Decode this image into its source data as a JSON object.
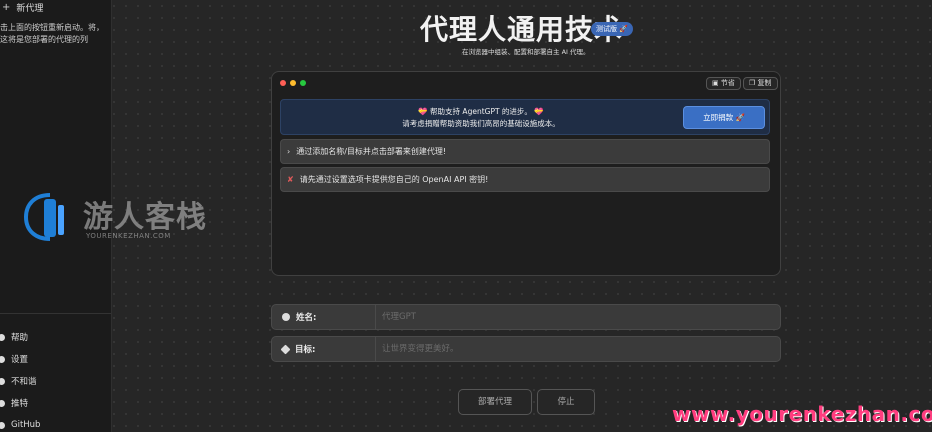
{
  "sidebar": {
    "new_agent": "新代理",
    "hint": "击上面的按钮重新启动。将，这将是您部署的代理的列",
    "links": [
      {
        "label": "帮助",
        "icon": "help-icon"
      },
      {
        "label": "设置",
        "icon": "gear-icon"
      },
      {
        "label": "不和谐",
        "icon": "discord-icon"
      },
      {
        "label": "推特",
        "icon": "twitter-icon"
      },
      {
        "label": "GitHub",
        "icon": "github-icon"
      }
    ]
  },
  "header": {
    "title": "代理人通用技术",
    "beta": "测试版 🚀",
    "subtitle": "在浏览器中组装、配置和部署自主 AI 代理。"
  },
  "window": {
    "save_label": "节省",
    "copy_label": "复制",
    "donate": {
      "line1": "💝 帮助支持 AgentGPT 的进步。 💝",
      "line2": "请考虑捐赠帮助资助我们高昂的基础设施成本。",
      "button": "立即捐款 🚀"
    },
    "messages": [
      {
        "icon": "chevron-right-icon",
        "glyph": "›",
        "text": "通过添加名称/目标并点击部署来创建代理!"
      },
      {
        "icon": "error-icon",
        "glyph": "✘",
        "text": "请先通过设置选项卡提供您自己的 OpenAI API 密钥!"
      }
    ]
  },
  "form": {
    "name_label": "姓名:",
    "name_placeholder": "代理GPT",
    "goal_label": "目标:",
    "goal_placeholder": "让世界变得更美好。"
  },
  "actions": {
    "deploy": "部署代理",
    "stop": "停止"
  },
  "watermark": {
    "title": "游人客栈",
    "subtitle": "YOURENKEZHAN.COM",
    "url": "www.yourenkezhan.com"
  },
  "colors": {
    "accent": "#3a6fc4",
    "watermark_pink": "#ff3d7f",
    "dot_red": "#ff5f56",
    "dot_yellow": "#ffbd2e",
    "dot_green": "#27c93f"
  }
}
